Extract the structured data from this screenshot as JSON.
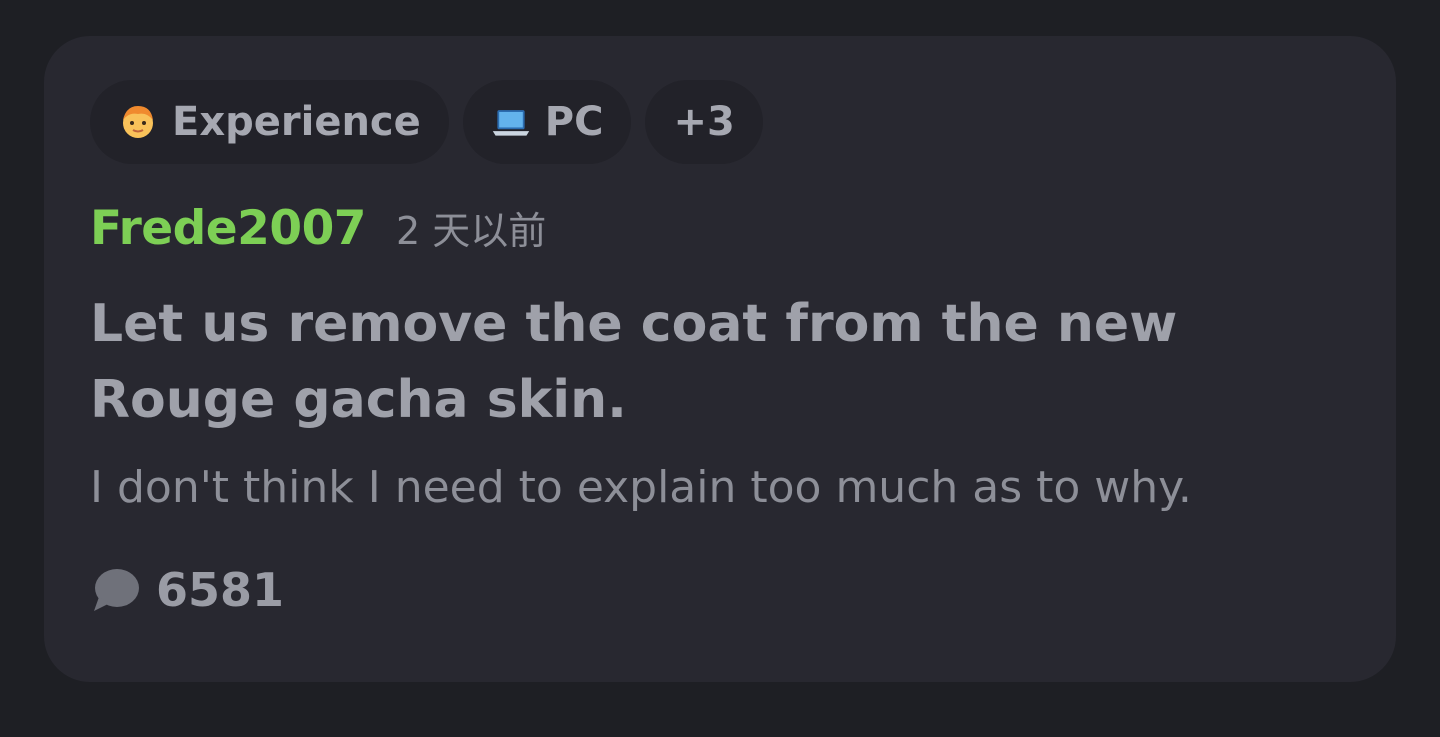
{
  "post": {
    "tags": [
      {
        "icon": "person-emoji-icon",
        "label": "Experience"
      },
      {
        "icon": "laptop-emoji-icon",
        "label": "PC"
      },
      {
        "icon": "",
        "label": "+3"
      }
    ],
    "author": "Frede2007",
    "time": "2 天以前",
    "title": "Let us remove the coat from the new Rouge gacha skin.",
    "body": "I don't think I need to explain too much as to why.",
    "comment_icon": "speech-bubble-icon",
    "comment_count": "6581"
  },
  "colors": {
    "background": "#1e1f24",
    "card": "#282830",
    "tag": "#222229",
    "author": "#7dcf55",
    "text": "#9fa1aa"
  }
}
